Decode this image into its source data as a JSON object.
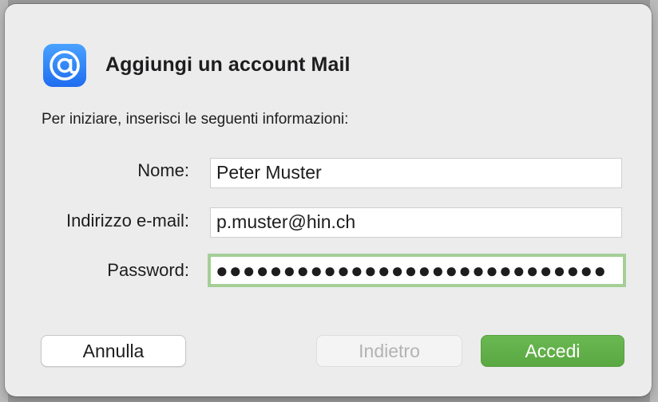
{
  "dialog": {
    "title": "Aggiungi un account Mail",
    "app_icon": "at-sign-mail-icon",
    "subtitle": "Per iniziare, inserisci le seguenti informazioni:"
  },
  "form": {
    "name_label": "Nome:",
    "name_value": "Peter Muster",
    "email_label": "Indirizzo e-mail:",
    "email_value": "p.muster@hin.ch",
    "password_label": "Password:",
    "password_value": "●●●●●●●●●●●●●●●●●●●●●●●●●●●●●"
  },
  "buttons": {
    "cancel_label": "Annulla",
    "back_label": "Indietro",
    "signin_label": "Accedi"
  },
  "colors": {
    "accent_green": "#5fae47",
    "focus_ring": "#a4cf96",
    "icon_blue": "#2f7df6"
  }
}
